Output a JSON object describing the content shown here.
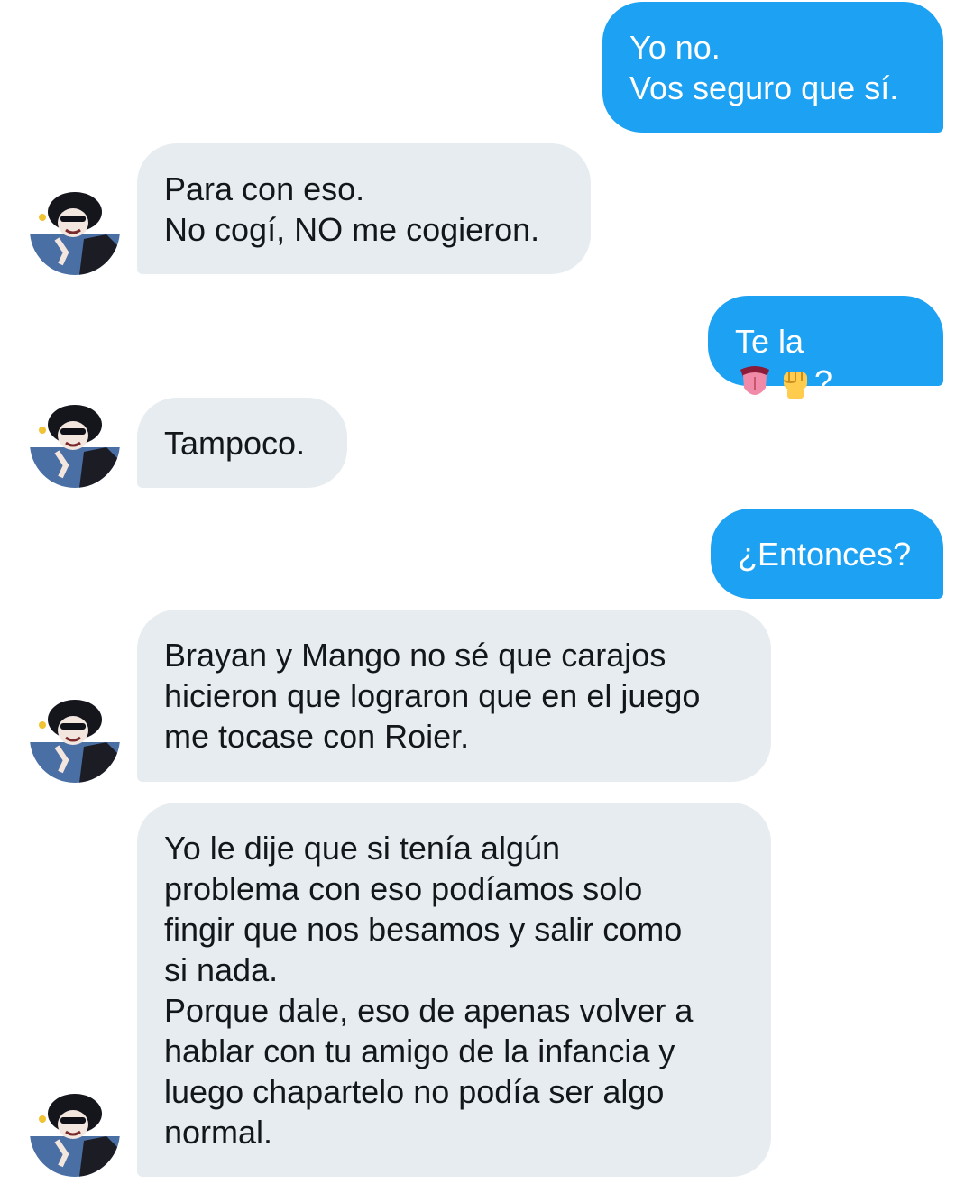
{
  "conversation": {
    "messages": [
      {
        "role": "sent",
        "text": "Yo no.\nVos seguro que sí."
      },
      {
        "role": "received",
        "text": "Para con eso.\nNo cogí, NO me cogieron."
      },
      {
        "role": "sent",
        "text_before": "Te la",
        "emojis": [
          "tongue-emoji",
          "raised-fist-emoji"
        ],
        "text_after": "?"
      },
      {
        "role": "received",
        "text": "Tampoco."
      },
      {
        "role": "sent",
        "text": "¿Entonces?"
      },
      {
        "role": "received",
        "text": "Brayan y Mango no sé que carajos\nhicieron que lograron que en el juego\nme tocase con Roier."
      },
      {
        "role": "received",
        "text": "Yo le dije que si tenía algún\nproblema con eso podíamos solo\nfingir que nos besamos y salir como\nsi nada.\nPorque dale, eso de apenas volver a\nhablar con tu amigo de la infancia y\nluego chapartelo no podía ser algo\nnormal."
      }
    ]
  },
  "colors": {
    "sent_bubble": "#1da1f2",
    "received_bubble": "#e6ecf0",
    "received_text": "#14171a",
    "background": "#ffffff"
  }
}
